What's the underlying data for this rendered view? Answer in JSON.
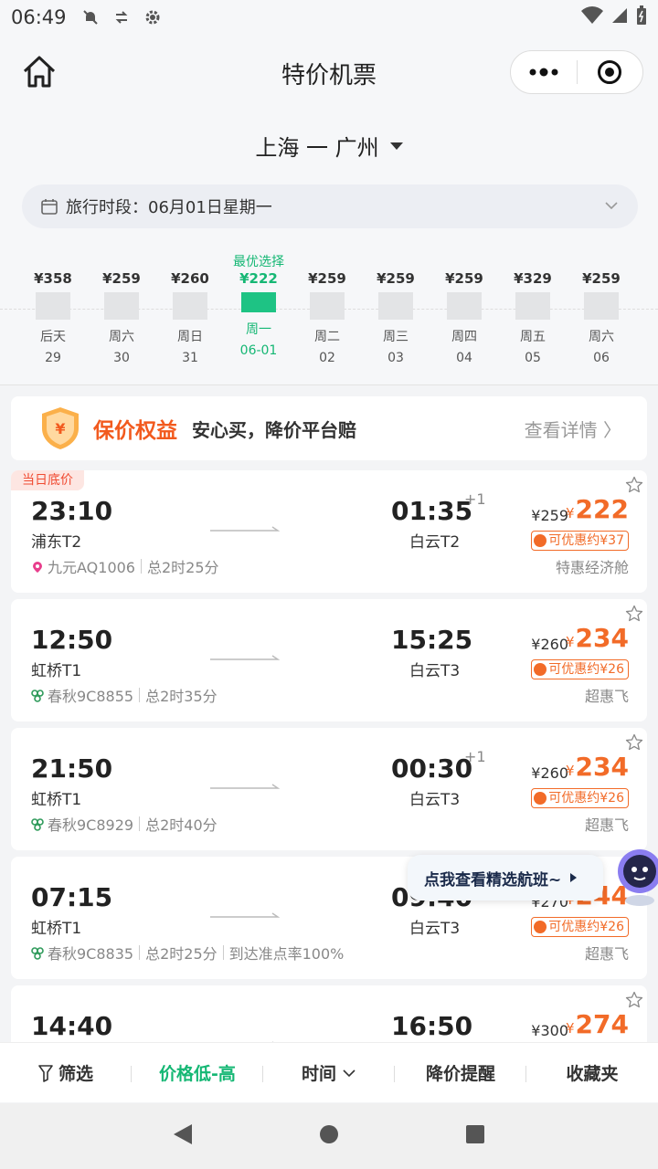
{
  "status_bar": {
    "time": "06:49"
  },
  "header": {
    "title": "特价机票"
  },
  "route": {
    "label": "上海 一 广州"
  },
  "period": {
    "label": "旅行时段：06月01日星期一"
  },
  "date_strip": {
    "best_label": "最优选择",
    "days": [
      {
        "price": "¥358",
        "weekday": "后天",
        "day": "29",
        "level": 0.75,
        "selected": false
      },
      {
        "price": "¥259",
        "weekday": "周六",
        "day": "30",
        "level": 0.7,
        "selected": false
      },
      {
        "price": "¥260",
        "weekday": "周日",
        "day": "31",
        "level": 0.7,
        "selected": false
      },
      {
        "price": "¥222",
        "weekday": "周一",
        "day": "06-01",
        "level": 0.55,
        "selected": true
      },
      {
        "price": "¥259",
        "weekday": "周二",
        "day": "02",
        "level": 0.7,
        "selected": false
      },
      {
        "price": "¥259",
        "weekday": "周三",
        "day": "03",
        "level": 0.7,
        "selected": false
      },
      {
        "price": "¥259",
        "weekday": "周四",
        "day": "04",
        "level": 0.7,
        "selected": false
      },
      {
        "price": "¥329",
        "weekday": "周五",
        "day": "05",
        "level": 0.75,
        "selected": false
      },
      {
        "price": "¥259",
        "weekday": "周六",
        "day": "06",
        "level": 0.7,
        "selected": false
      }
    ]
  },
  "promo": {
    "title": "保价权益",
    "subtitle": "安心买，降价平台赔",
    "more": "查看详情 〉"
  },
  "flights": [
    {
      "tag": "当日底价",
      "dep_time": "23:10",
      "dep_airport": "浦东T2",
      "arr_time": "01:35",
      "plus": "+1",
      "arr_airport": "白云T2",
      "airline": "九元AQ1006",
      "duration": "总2时25分",
      "extra": "",
      "orig_price": "¥259",
      "price": "222",
      "discount": "可优惠约¥37",
      "cabin": "特惠经济舱",
      "logo": "pin"
    },
    {
      "tag": "",
      "dep_time": "12:50",
      "dep_airport": "虹桥T1",
      "arr_time": "15:25",
      "plus": "",
      "arr_airport": "白云T3",
      "airline": "春秋9C8855",
      "duration": "总2时35分",
      "extra": "",
      "orig_price": "¥260",
      "price": "234",
      "discount": "可优惠约¥26",
      "cabin": "超惠飞",
      "logo": "spring"
    },
    {
      "tag": "",
      "dep_time": "21:50",
      "dep_airport": "虹桥T1",
      "arr_time": "00:30",
      "plus": "+1",
      "arr_airport": "白云T3",
      "airline": "春秋9C8929",
      "duration": "总2时40分",
      "extra": "",
      "orig_price": "¥260",
      "price": "234",
      "discount": "可优惠约¥26",
      "cabin": "超惠飞",
      "logo": "spring"
    },
    {
      "tag": "",
      "dep_time": "07:15",
      "dep_airport": "虹桥T1",
      "arr_time": "09:40",
      "plus": "",
      "arr_airport": "白云T3",
      "airline": "春秋9C8835",
      "duration": "总2时25分",
      "extra": "到达准点率100%",
      "orig_price": "¥270",
      "price": "244",
      "discount": "可优惠约¥26",
      "cabin": "超惠飞",
      "logo": "spring"
    },
    {
      "tag": "",
      "dep_time": "14:40",
      "dep_airport": "",
      "arr_time": "16:50",
      "plus": "",
      "arr_airport": "",
      "airline": "",
      "duration": "",
      "extra": "",
      "orig_price": "¥300",
      "price": "274",
      "discount": "",
      "cabin": "",
      "logo": ""
    }
  ],
  "bubble": {
    "label": "点我查看精选航班~"
  },
  "toolbar": {
    "filter": "筛选",
    "price": "价格低-高",
    "time": "时间",
    "alert": "降价提醒",
    "favorites": "收藏夹"
  },
  "colors": {
    "accent": "#15b774",
    "price": "#f26b28",
    "promo": "#f25a1e"
  }
}
